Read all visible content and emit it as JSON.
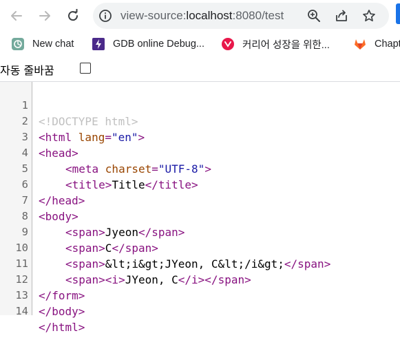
{
  "toolbar": {
    "url_scheme": "view-source:",
    "url_host": "localhost",
    "url_rest": ":8080/test"
  },
  "bookmarks": [
    {
      "label": "New chat",
      "icon": "chatgpt-icon"
    },
    {
      "label": "GDB online Debug...",
      "icon": "gdb-icon"
    },
    {
      "label": "커리어 성장을 위한...",
      "icon": "career-icon"
    },
    {
      "label": "Chapt",
      "icon": "gitlab-icon"
    }
  ],
  "wrap": {
    "label": "자동 줄바꿈",
    "checked": false
  },
  "source": {
    "lines": [
      {
        "n": "1"
      },
      {
        "n": "2"
      },
      {
        "n": "3"
      },
      {
        "n": "4"
      },
      {
        "n": "5"
      },
      {
        "n": "6"
      },
      {
        "n": "7"
      },
      {
        "n": "8"
      },
      {
        "n": "9"
      },
      {
        "n": "10"
      },
      {
        "n": "11"
      },
      {
        "n": "12"
      },
      {
        "n": "13"
      },
      {
        "n": "14"
      }
    ],
    "code": {
      "l1": "<!DOCTYPE html>",
      "l2_open": "<html ",
      "l2_attr": "lang",
      "l2_eq": "=",
      "l2_val": "\"en\"",
      "l2_close": ">",
      "l3": "<head>",
      "l4_open": "<meta ",
      "l4_attr": "charset",
      "l4_eq": "=",
      "l4_val": "\"UTF-8\"",
      "l4_close": ">",
      "l5_open": "<title>",
      "l5_text": "Title",
      "l5_close": "</title>",
      "l6": "</head>",
      "l7": "<body>",
      "l8_open": "<span>",
      "l8_text": "Jyeon",
      "l8_close": "</span>",
      "l9_open": "<span>",
      "l9_text": "C",
      "l9_close": "</span>",
      "l10_open": "<span>",
      "l10_text": "&lt;i&gt;JYeon, C&lt;/i&gt;",
      "l10_close": "</span>",
      "l11_open": "<span>",
      "l11_iopen": "<i>",
      "l11_text": "JYeon, C",
      "l11_iclose": "</i>",
      "l11_close": "</span>",
      "l12": "</form>",
      "l13": "</body>",
      "l14": "</html>"
    }
  }
}
